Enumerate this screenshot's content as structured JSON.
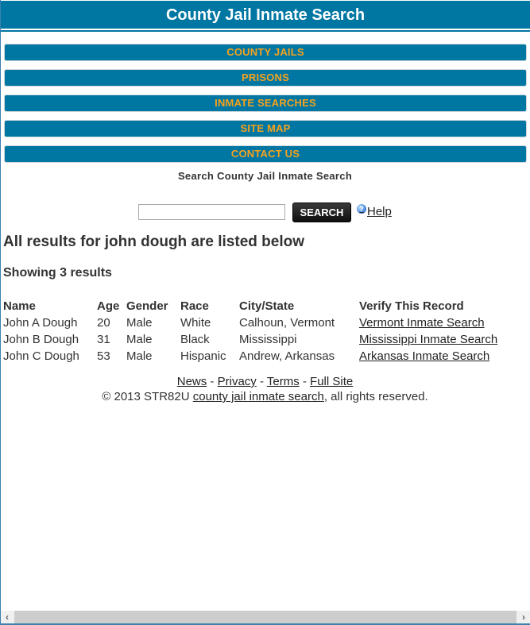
{
  "header": {
    "title": "County Jail Inmate Search"
  },
  "colors": {
    "brand_blue": "#0077a2",
    "nav_text_orange": "#f6a21e",
    "button_dark": "#1a1a1a"
  },
  "nav": {
    "items": [
      {
        "label": "COUNTY JAILS"
      },
      {
        "label": "PRISONS"
      },
      {
        "label": "INMATE SEARCHES"
      },
      {
        "label": "SITE MAP"
      },
      {
        "label": "CONTACT US"
      }
    ]
  },
  "search": {
    "title": "Search County Jail Inmate Search",
    "input_value": "",
    "input_placeholder": "",
    "button_label": "SEARCH",
    "help_icon": "question-circle-icon",
    "help_label": "Help"
  },
  "results": {
    "heading": "All results for john dough are listed below",
    "count_text": "Showing 3 results",
    "columns": [
      "Name",
      "Age",
      "Gender",
      "Race",
      "City/State",
      "Verify This Record"
    ],
    "rows": [
      {
        "name": "John A Dough",
        "age": "20",
        "gender": "Male",
        "race": "White",
        "city_state": "Calhoun, Vermont",
        "verify_link": "Vermont Inmate Search"
      },
      {
        "name": "John B Dough",
        "age": "31",
        "gender": "Male",
        "race": "Black",
        "city_state": "Mississippi",
        "verify_link": "Mississippi Inmate Search"
      },
      {
        "name": "John C Dough",
        "age": "53",
        "gender": "Male",
        "race": "Hispanic",
        "city_state": "Andrew, Arkansas",
        "verify_link": "Arkansas Inmate Search"
      }
    ]
  },
  "footer": {
    "links": [
      "News",
      "Privacy",
      "Terms",
      "Full Site"
    ],
    "separator": " - ",
    "copyright_prefix": "© 2013 STR82U ",
    "copyright_link": "county jail inmate search",
    "copyright_suffix": ", all rights reserved."
  },
  "scrollbar": {
    "left_arrow": "‹",
    "right_arrow": "›"
  }
}
